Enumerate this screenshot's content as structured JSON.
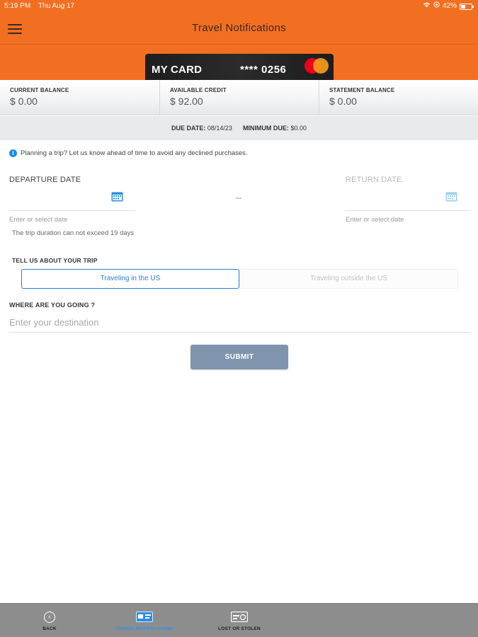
{
  "status_bar": {
    "time": "5:19 PM",
    "date": "Thu Aug 17",
    "battery": "42%"
  },
  "header": {
    "title": "Travel Notifications"
  },
  "card": {
    "name": "MY CARD",
    "number": "**** 0256"
  },
  "balances": [
    {
      "label": "CURRENT BALANCE",
      "value": "$ 0.00"
    },
    {
      "label": "AVAILABLE CREDIT",
      "value": "$ 92.00"
    },
    {
      "label": "STATEMENT BALANCE",
      "value": "$ 0.00"
    }
  ],
  "due": {
    "due_label": "DUE DATE:",
    "due_value": "08/14/23",
    "min_label": "MINIMUM DUE:",
    "min_value": "$0.00"
  },
  "form": {
    "info_text": "Planning a trip? Let us know ahead of time to avoid any declined purchases.",
    "departure_label": "DEPARTURE DATE",
    "return_label": "RETURN DATE",
    "date_separator": "--",
    "date_hint": "Enter or select date",
    "duration_note": "The trip duration can not exceed 19 days",
    "trip_label": "TELL US ABOUT YOUR TRIP",
    "option_us": "Traveling in the US",
    "option_outside": "Traveling outside the US",
    "destination_label": "WHERE ARE YOU GOING ?",
    "destination_placeholder": "Enter your destination",
    "destination_value": "",
    "submit": "SUBMIT"
  },
  "tabbar": {
    "back": "BACK",
    "travel": "TRAVEL NOTIFICATIONS",
    "lost": "LOST OR STOLEN"
  },
  "colors": {
    "brand_orange": "#f26f22",
    "accent_blue": "#2a7fd4",
    "submit_gray_blue": "#7f95ae",
    "tabbar_gray": "#8d8d8e"
  }
}
